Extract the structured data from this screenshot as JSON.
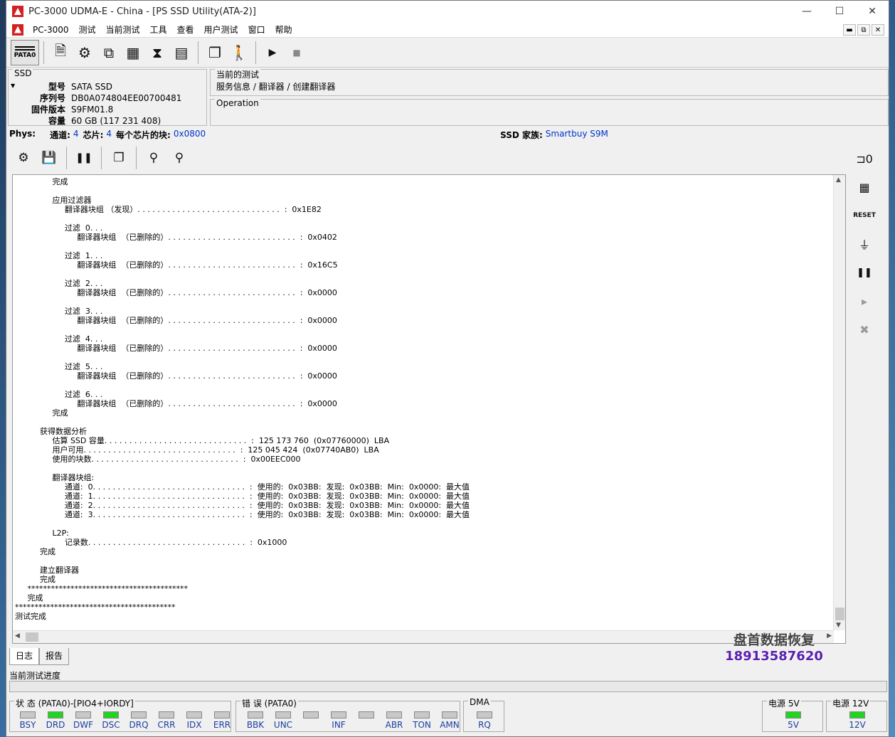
{
  "window": {
    "title": "PC-3000 UDMA-E - China - [PS SSD Utility(ATA-2)]",
    "controls": [
      "—",
      "☐",
      "✕"
    ]
  },
  "menu": {
    "items": [
      "PC-3000",
      "测试",
      "当前测试",
      "工具",
      "查看",
      "用户测试",
      "窗口",
      "帮助"
    ],
    "mdi": [
      "▬",
      "⧉",
      "✕"
    ]
  },
  "toolbar": {
    "pata_label": "PATA0"
  },
  "ssd": {
    "legend": "SSD",
    "rows": [
      {
        "k": "型号",
        "v": "SATA SSD"
      },
      {
        "k": "序列号",
        "v": "DB0A074804EE00700481"
      },
      {
        "k": "固件版本",
        "v": "S9FM01.8"
      },
      {
        "k": "容量",
        "v": "60 GB (117 231 408)"
      }
    ]
  },
  "current_test": {
    "legend": "当前的测试",
    "path": "服务信息 / 翻译器 / 创建翻译器"
  },
  "operation": {
    "legend": "Operation"
  },
  "phys": {
    "label": "Phys:",
    "channels_label": "通道:",
    "channels": "4",
    "chips_label": "芯片:",
    "chips": "4",
    "blocks_label": "每个芯片的块:",
    "blocks": "0x0800",
    "family_label": "SSD 家族:",
    "family": "Smartbuy S9M"
  },
  "log_lines": [
    "               完成",
    "",
    "               应用过滤器",
    "                    翻译器块组 （发现）. . . . . . . . . . . . . . . . . . . . . . . . . . . . .  :  0x1E82",
    "",
    "                    过滤  0. . .",
    "                         翻译器块组  （已删除的）. . . . . . . . . . . . . . . . . . . . . . . . . .  :  0x0402",
    "",
    "                    过滤  1. . .",
    "                         翻译器块组  （已删除的）. . . . . . . . . . . . . . . . . . . . . . . . . .  :  0x16C5",
    "",
    "                    过滤  2. . .",
    "                         翻译器块组  （已删除的）. . . . . . . . . . . . . . . . . . . . . . . . . .  :  0x0000",
    "",
    "                    过滤  3. . .",
    "                         翻译器块组  （已删除的）. . . . . . . . . . . . . . . . . . . . . . . . . .  :  0x0000",
    "",
    "                    过滤  4. . .",
    "                         翻译器块组  （已删除的）. . . . . . . . . . . . . . . . . . . . . . . . . .  :  0x0000",
    "",
    "                    过滤  5. . .",
    "                         翻译器块组  （已删除的）. . . . . . . . . . . . . . . . . . . . . . . . . .  :  0x0000",
    "",
    "                    过滤  6. . .",
    "                         翻译器块组  （已删除的）. . . . . . . . . . . . . . . . . . . . . . . . . .  :  0x0000",
    "               完成",
    "",
    "          获得数据分析",
    "               估算 SSD 容量. . . . . . . . . . . . . . . . . . . . . . . . . . . . .  :  125 173 760  (0x07760000)  LBA",
    "               用户可用. . . . . . . . . . . . . . . . . . . . . . . . . . . . . . .  :  125 045 424  (0x07740AB0)  LBA",
    "               使用的块数. . . . . . . . . . . . . . . . . . . . . . . . . . . . . .  :  0x00EEC000",
    "",
    "               翻译器块组:",
    "                    通道:  0. . . . . . . . . . . . . . . . . . . . . . . . . . . . . . .  :  使用的:  0x03BB:  发现:  0x03BB:  Min:  0x0000:  最大值",
    "                    通道:  1. . . . . . . . . . . . . . . . . . . . . . . . . . . . . . .  :  使用的:  0x03BB:  发现:  0x03BB:  Min:  0x0000:  最大值",
    "                    通道:  2. . . . . . . . . . . . . . . . . . . . . . . . . . . . . . .  :  使用的:  0x03BB:  发现:  0x03BB:  Min:  0x0000:  最大值",
    "                    通道:  3. . . . . . . . . . . . . . . . . . . . . . . . . . . . . . .  :  使用的:  0x03BB:  发现:  0x03BB:  Min:  0x0000:  最大值",
    "",
    "               L2P:",
    "                    记录数. . . . . . . . . . . . . . . . . . . . . . . . . . . . . . . .  :  0x1000",
    "          完成",
    "",
    "          建立翻译器",
    "          完成",
    "     *****************************************",
    "     完成",
    "*****************************************",
    "测试完成"
  ],
  "watermark": {
    "line1": "盘首数据恢复",
    "line2": "18913587620"
  },
  "tabs": [
    "日志",
    "报告"
  ],
  "progress": {
    "label": "当前测试进度",
    "value": 0
  },
  "status_groups": {
    "state": {
      "label": "状 态 (PATA0)-[PIO4+IORDY]",
      "indicators": [
        {
          "name": "BSY",
          "on": false
        },
        {
          "name": "DRD",
          "on": true
        },
        {
          "name": "DWF",
          "on": false
        },
        {
          "name": "DSC",
          "on": true
        },
        {
          "name": "DRQ",
          "on": false
        },
        {
          "name": "CRR",
          "on": false
        },
        {
          "name": "IDX",
          "on": false
        },
        {
          "name": "ERR",
          "on": false
        }
      ]
    },
    "error": {
      "label": "错 误 (PATA0)",
      "indicators": [
        {
          "name": "BBK",
          "on": false
        },
        {
          "name": "UNC",
          "on": false
        },
        {
          "name": "",
          "on": false
        },
        {
          "name": "INF",
          "on": false
        },
        {
          "name": "",
          "on": false
        },
        {
          "name": "ABR",
          "on": false
        },
        {
          "name": "TON",
          "on": false
        },
        {
          "name": "AMN",
          "on": false
        }
      ]
    },
    "dma": {
      "label": "DMA",
      "indicators": [
        {
          "name": "RQ",
          "on": false
        }
      ]
    },
    "power5": {
      "label": "电源 5V",
      "indicators": [
        {
          "name": "5V",
          "on": true
        }
      ]
    },
    "power12": {
      "label": "电源 12V",
      "indicators": [
        {
          "name": "12V",
          "on": true
        }
      ]
    }
  },
  "colors": {
    "led_on": "#22d422",
    "led_off": "#c8c8c8",
    "link_blue": "#0033cc"
  }
}
